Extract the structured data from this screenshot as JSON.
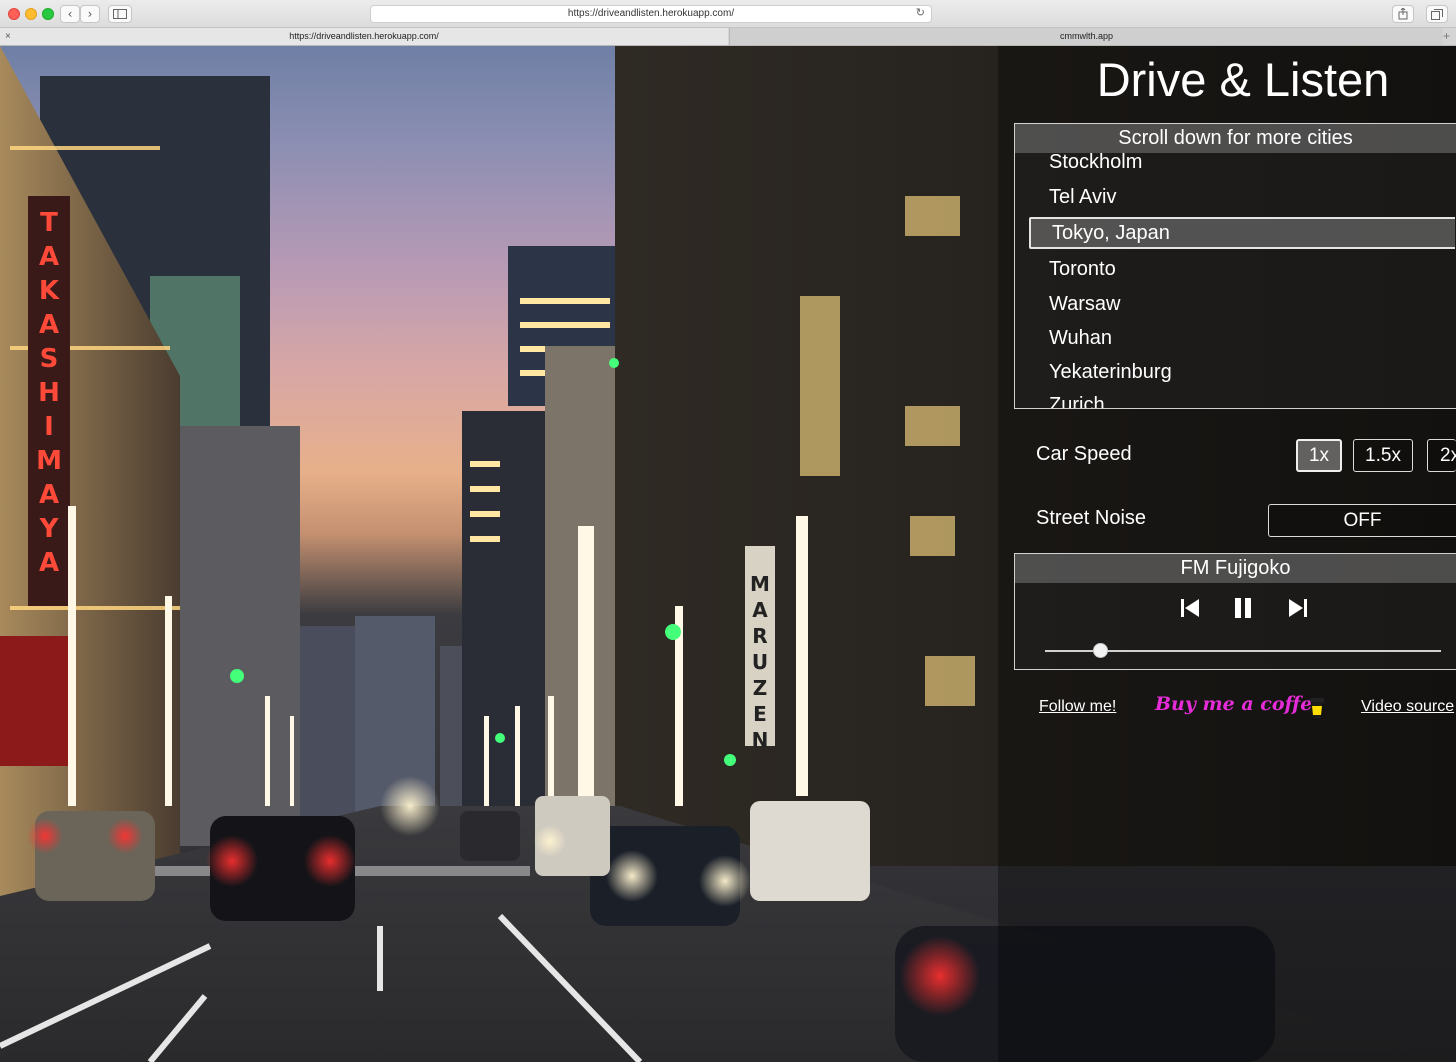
{
  "browser": {
    "url": "https://driveandlisten.herokuapp.com/",
    "tabs": [
      {
        "label": "https://driveandlisten.herokuapp.com/"
      },
      {
        "label": "cmmwlth.app"
      }
    ],
    "icons": [
      "back-icon",
      "forward-icon",
      "sidebar-icon",
      "reload-icon",
      "share-icon",
      "tabs-icon",
      "close-tab-icon",
      "new-tab-icon"
    ]
  },
  "app": {
    "title": "Drive & Listen",
    "city_list": {
      "header": "Scroll down for more cities",
      "items": [
        "Stockholm",
        "Tel Aviv",
        "Tokyo, Japan",
        "Toronto",
        "Warsaw",
        "Wuhan",
        "Yekaterinburg",
        "Zurich"
      ],
      "selected": "Tokyo, Japan"
    },
    "car_speed": {
      "label": "Car Speed",
      "options": [
        "1x",
        "1.5x",
        "2x"
      ],
      "selected": "1x"
    },
    "street_noise": {
      "label": "Street Noise",
      "value": "OFF"
    },
    "radio": {
      "station": "FM Fujigoko",
      "icons": [
        "previous-icon",
        "pause-icon",
        "next-icon"
      ],
      "volume": 0.14
    },
    "footer": {
      "follow": "Follow me!",
      "coffee": "Buy me a coffee",
      "source": "Video source"
    },
    "signs": {
      "takashimaya": "TAKASHIMAYA",
      "maruzen": "MARUZEN"
    }
  }
}
